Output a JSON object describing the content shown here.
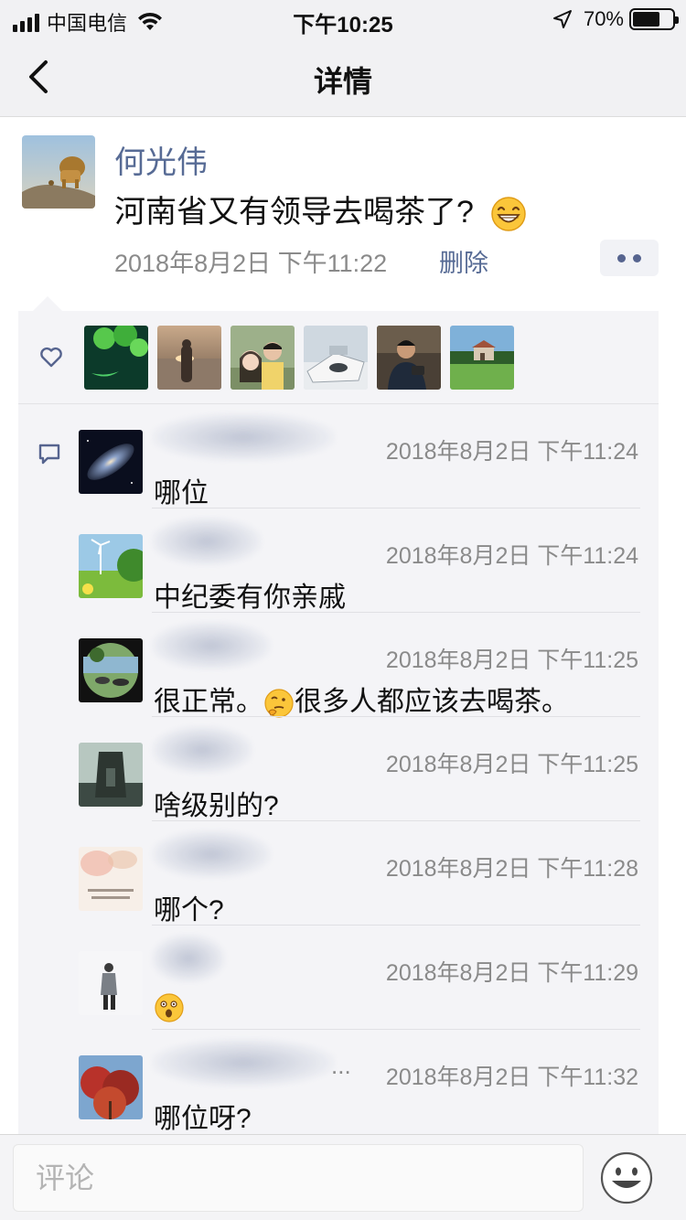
{
  "status_bar": {
    "carrier": "中国电信",
    "time": "下午10:25",
    "battery": "70%",
    "battery_level": 0.7
  },
  "nav": {
    "title": "详情"
  },
  "post": {
    "author": "何光伟",
    "text": "河南省又有领导去喝茶了?",
    "time": "2018年8月2日 下午11:22",
    "delete_label": "删除"
  },
  "likes": {
    "count": 6
  },
  "comments": [
    {
      "time": "2018年8月2日 下午11:24",
      "text": "哪位"
    },
    {
      "time": "2018年8月2日 下午11:24",
      "text": "中纪委有你亲戚"
    },
    {
      "time": "2018年8月2日 下午11:25",
      "text_before": "很正常。",
      "text_after": "很多人都应该去喝茶。"
    },
    {
      "time": "2018年8月2日 下午11:25",
      "text": "啥级别的?"
    },
    {
      "time": "2018年8月2日 下午11:28",
      "text": "哪个?"
    },
    {
      "time": "2018年8月2日 下午11:29",
      "text": ""
    },
    {
      "time": "2018年8月2日 下午11:32",
      "text": "哪位呀?",
      "name_suffix": "..."
    }
  ],
  "input": {
    "placeholder": "评论"
  },
  "icons": {
    "back": "chevron-left-icon",
    "heart": "heart-icon",
    "comment": "comment-icon",
    "emoji": "smiley-icon"
  }
}
